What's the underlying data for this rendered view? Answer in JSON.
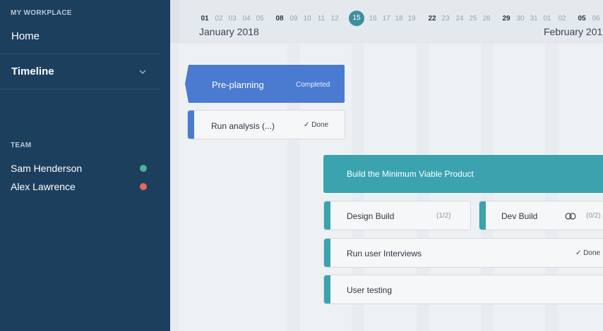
{
  "sidebar": {
    "workplace_label": "MY WORKPLACE",
    "home_label": "Home",
    "timeline_label": "Timeline",
    "team_label": "TEAM",
    "members": [
      {
        "name": "Sam Henderson",
        "status_color": "#4db393"
      },
      {
        "name": "Alex Lawrence",
        "status_color": "#e8685a"
      }
    ]
  },
  "timeline": {
    "days_jan": [
      "01",
      "02",
      "03",
      "04",
      "05",
      "08",
      "09",
      "10",
      "11",
      "12",
      "15",
      "16",
      "17",
      "18",
      "19",
      "22",
      "23",
      "24",
      "25",
      "26",
      "29",
      "30",
      "31"
    ],
    "days_feb": [
      "01",
      "02",
      "05",
      "06"
    ],
    "today": "15",
    "month_jan": "January 2018",
    "month_feb": "February 201"
  },
  "items": {
    "preplanning": {
      "label": "Pre-planning",
      "status": "Completed",
      "color": "#4a7bd0"
    },
    "run_analysis": {
      "label": "Run analysis (...)",
      "status": "Done",
      "check": "✓"
    },
    "mvp": {
      "label": "Build the Minimum Viable Product",
      "color": "#3aa3ae"
    },
    "design_build": {
      "label": "Design Build",
      "progress": "(1/2)"
    },
    "dev_build": {
      "label": "Dev Build",
      "progress": "(0/2)",
      "icon": "link-icon"
    },
    "user_interviews": {
      "label": "Run user Interviews",
      "status": "Done",
      "check": "✓"
    },
    "user_testing": {
      "label": "User testing"
    }
  }
}
